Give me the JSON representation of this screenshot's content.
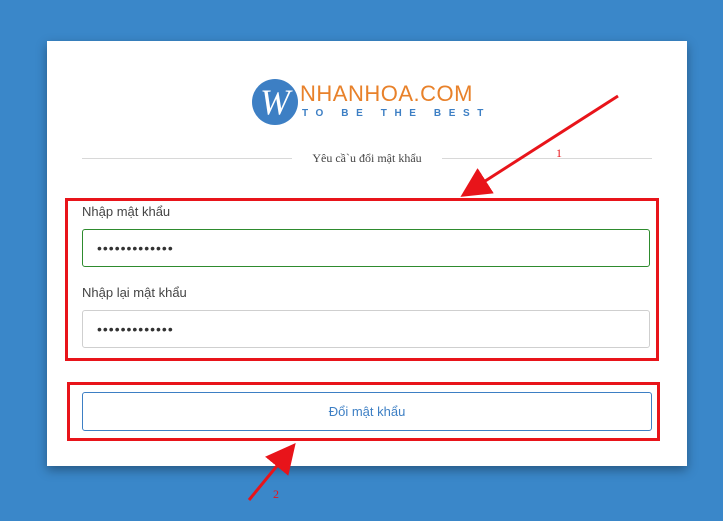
{
  "logo": {
    "mark": "W",
    "name": "NHANHOA.COM",
    "tagline": "TO BE THE BEST"
  },
  "form": {
    "title": "Yêu cầ`u đổi mật khẩu",
    "password": {
      "label": "Nhập mật khẩu",
      "value": "•••••••••••••"
    },
    "confirm_password": {
      "label": "Nhập lại mật khẩu",
      "value": "•••••••••••••"
    },
    "submit_label": "Đổi mật khẩu"
  },
  "annotations": {
    "marker_1": "1",
    "marker_2": "2",
    "color": "#e8141a"
  },
  "colors": {
    "background": "#3a87c9",
    "brand_blue": "#3d7fc4",
    "brand_orange": "#e8812a",
    "focus_green": "#2e8b2e"
  }
}
